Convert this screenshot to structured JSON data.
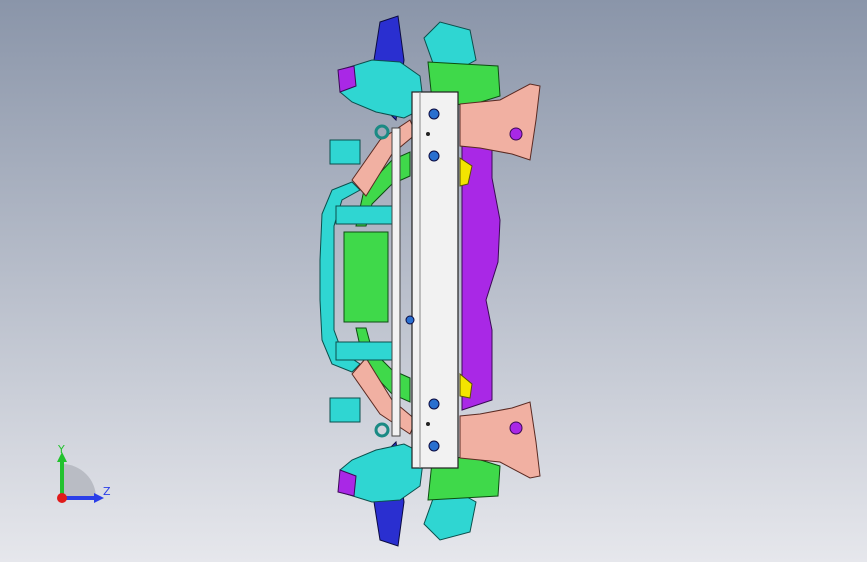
{
  "viewport": {
    "colors": {
      "background_top": "#8a95a9",
      "background_bottom": "#e6e7ec",
      "axis_y": "#22c22e",
      "axis_z": "#2a3ee8",
      "axis_x": "#e01a1a",
      "plate": "#f2f2f2",
      "cyan": "#2fd6d2",
      "magenta": "#a928e6",
      "salmon": "#f1b0a2",
      "green": "#3fd94a",
      "blue": "#2a2fd0",
      "yellow": "#f3e400",
      "teal": "#1a8a84"
    }
  },
  "triad": {
    "y_label": "Y",
    "z_label": "Z",
    "icons": [
      "triad-y-axis-icon",
      "triad-z-axis-icon",
      "triad-x-axis-icon"
    ]
  }
}
